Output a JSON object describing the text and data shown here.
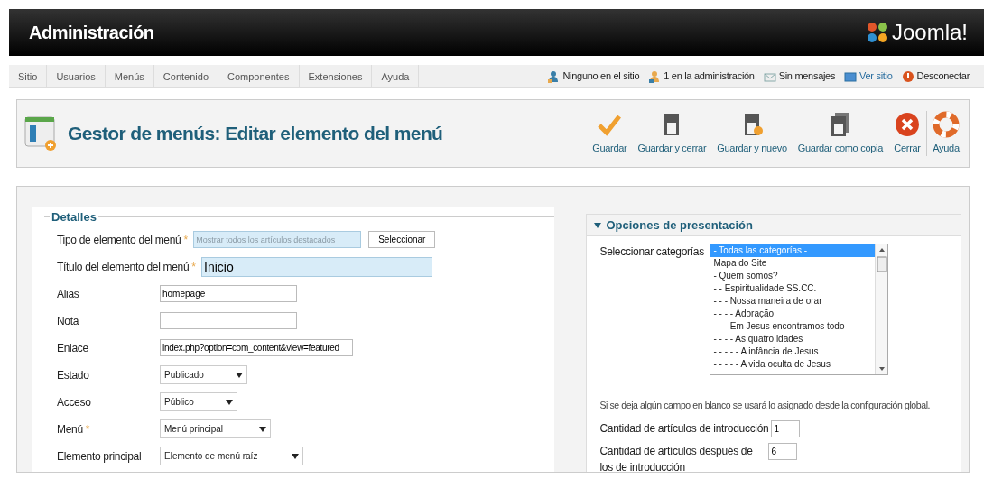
{
  "header": {
    "title": "Administración",
    "logo": "Joomla!"
  },
  "menu": {
    "items": [
      "Sitio",
      "Usuarios",
      "Menús",
      "Contenido",
      "Componentes",
      "Extensiones",
      "Ayuda"
    ]
  },
  "status": {
    "items": [
      {
        "kind": "visitors",
        "text": "Ninguno en el sitio"
      },
      {
        "kind": "admins",
        "text": "1 en la administración"
      },
      {
        "kind": "messages",
        "text": "Sin mensajes"
      },
      {
        "kind": "view",
        "text": "Ver sitio"
      },
      {
        "kind": "logout",
        "text": "Desconectar"
      }
    ]
  },
  "toolbar": {
    "title": "Gestor de menús: Editar elemento del menú",
    "buttons": [
      {
        "kind": "save",
        "label": "Guardar"
      },
      {
        "kind": "save-close",
        "label": "Guardar y cerrar"
      },
      {
        "kind": "save-new",
        "label": "Guardar y nuevo"
      },
      {
        "kind": "save-copy",
        "label": "Guardar como copia"
      },
      {
        "kind": "close",
        "label": "Cerrar"
      },
      {
        "kind": "help",
        "label": "Ayuda"
      }
    ]
  },
  "details": {
    "legend": "Detalles",
    "fields": [
      {
        "kind": "picker",
        "label": "Tipo de elemento del menú",
        "required_mark": "*",
        "value": "Mostrar todos los artículos destacados",
        "button": "Seleccionar",
        "highlighted": true
      },
      {
        "kind": "title",
        "label": "Título del elemento del menú",
        "required_mark": "*",
        "value": "Inicio",
        "highlighted": true
      },
      {
        "kind": "input",
        "label": "Alias",
        "value": "homepage",
        "highlighted": false
      },
      {
        "kind": "input",
        "label": "Nota",
        "highlighted": false
      },
      {
        "kind": "input",
        "label": "Enlace",
        "value": "index.php?option=com_content&view=featured",
        "highlighted": false
      },
      {
        "kind": "select",
        "label": "Estado",
        "value": "Publicado"
      },
      {
        "kind": "select",
        "label": "Acceso",
        "value": "Público"
      },
      {
        "kind": "select",
        "label": "Menú",
        "required_mark": "*",
        "value": "Menú principal"
      },
      {
        "kind": "select",
        "label": "Elemento principal",
        "value": "Elemento de menú raíz"
      }
    ]
  },
  "presentation": {
    "heading": "Opciones de presentación",
    "expanded": true,
    "categories": {
      "label": "Seleccionar categorías",
      "options": [
        {
          "text": "- Todas las categorías -",
          "selected": true
        },
        {
          "text": "Mapa do Site",
          "selected": false
        },
        {
          "text": "- Quem somos?",
          "selected": false
        },
        {
          "text": "- - Espiritualidade SS.CC.",
          "selected": false
        },
        {
          "text": "- - - Nossa maneira de orar",
          "selected": false
        },
        {
          "text": "- - - - Adoração",
          "selected": false
        },
        {
          "text": "- - - Em Jesus encontramos todo",
          "selected": false
        },
        {
          "text": "- - - - As quatro idades",
          "selected": false
        },
        {
          "text": "- - - - - A infância de Jesus",
          "selected": false
        },
        {
          "text": "- - - - - A vida oculta de Jesus",
          "selected": false
        }
      ]
    },
    "note": "Si se deja algún campo en blanco se usará lo asignado desde la configuración global.",
    "fields": [
      {
        "label": "Cantidad de artículos de introducción",
        "value": "1"
      },
      {
        "label": "Cantidad de artículos después de los de introducción",
        "value": "6"
      }
    ]
  }
}
